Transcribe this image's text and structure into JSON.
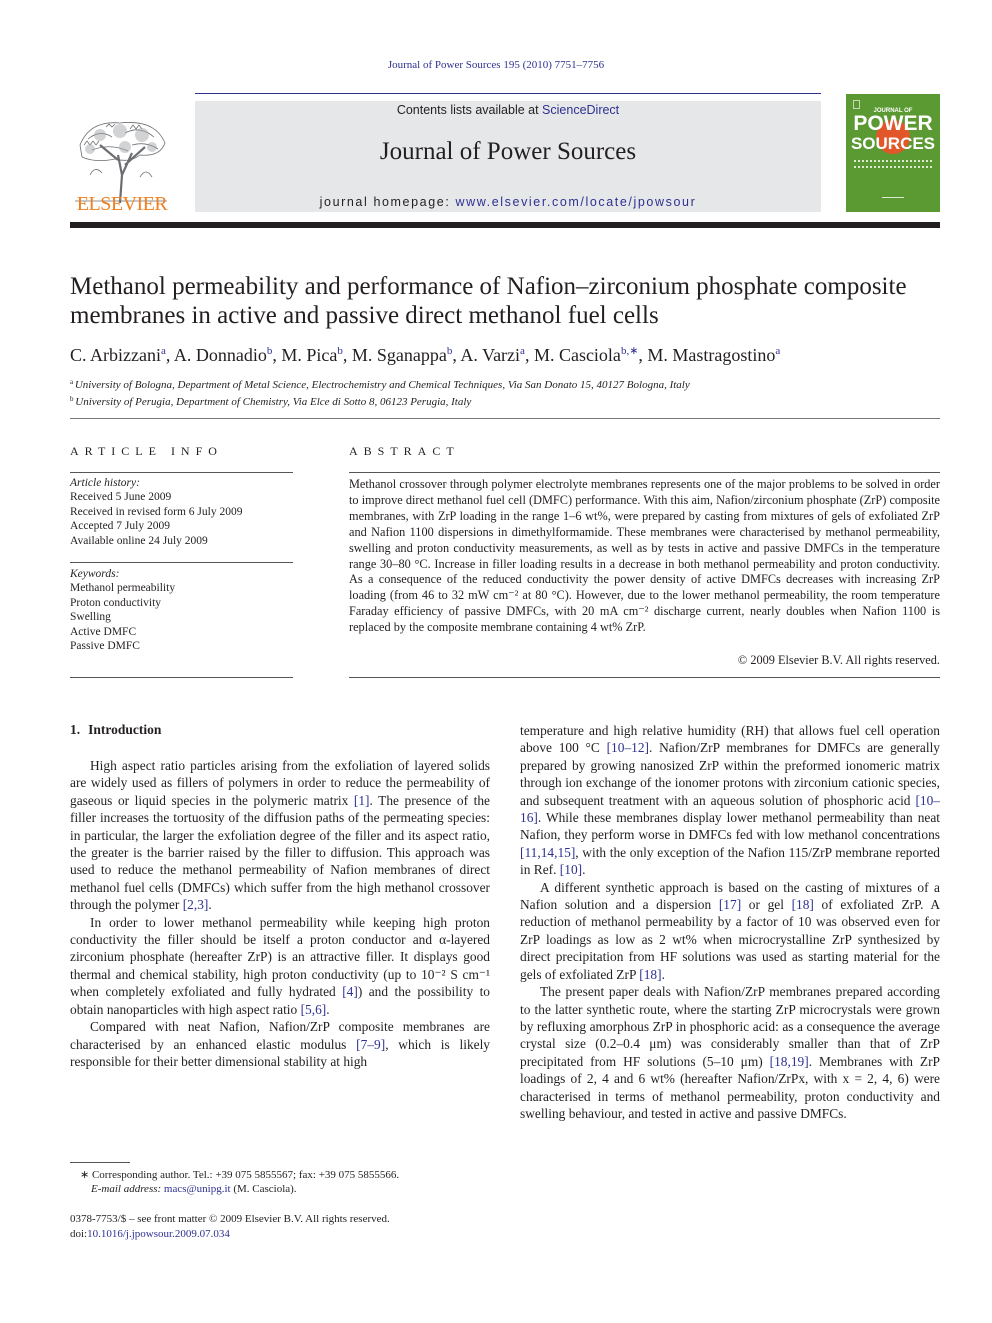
{
  "header": {
    "journal_ref": "Journal of Power Sources 195 (2010) 7751–7756",
    "contents_prefix": "Contents lists available at ",
    "contents_link": "ScienceDirect",
    "journal_title": "Journal of Power Sources",
    "homepage_prefix": "journal homepage: ",
    "homepage_link": "www.elsevier.com/locate/jpowsour",
    "publisher_logo_text": "ELSEVIER",
    "cover": {
      "line1": "JOURNAL OF",
      "line2": "POWER",
      "line3": "SOURCES"
    },
    "colors": {
      "link": "#2e3192",
      "elsevier_orange": "#f07f1d",
      "cover_green": "#5b9a32",
      "header_box": "#e6e7e8"
    }
  },
  "article": {
    "title": "Methanol permeability and performance of Nafion–zirconium phosphate composite membranes in active and passive direct methanol fuel cells",
    "authors": [
      {
        "name": "C. Arbizzani",
        "sup": "a"
      },
      {
        "name": "A. Donnadio",
        "sup": "b"
      },
      {
        "name": "M. Pica",
        "sup": "b"
      },
      {
        "name": "M. Sganappa",
        "sup": "b"
      },
      {
        "name": "A. Varzi",
        "sup": "a"
      },
      {
        "name": "M. Casciola",
        "sup": "b,∗"
      },
      {
        "name": "M. Mastragostino",
        "sup": "a"
      }
    ],
    "affiliations": [
      {
        "sup": "a",
        "text": "University of Bologna, Department of Metal Science, Electrochemistry and Chemical Techniques, Via San Donato 15, 40127 Bologna, Italy"
      },
      {
        "sup": "b",
        "text": "University of Perugia, Department of Chemistry, Via Elce di Sotto 8, 06123 Perugia, Italy"
      }
    ]
  },
  "article_info": {
    "heading": "ARTICLE INFO",
    "history_label": "Article history:",
    "history": [
      "Received 5 June 2009",
      "Received in revised form 6 July 2009",
      "Accepted 7 July 2009",
      "Available online 24 July 2009"
    ],
    "keywords_label": "Keywords:",
    "keywords": [
      "Methanol permeability",
      "Proton conductivity",
      "Swelling",
      "Active DMFC",
      "Passive DMFC"
    ]
  },
  "abstract": {
    "heading": "ABSTRACT",
    "body": "Methanol crossover through polymer electrolyte membranes represents one of the major problems to be solved in order to improve direct methanol fuel cell (DMFC) performance. With this aim, Nafion/zirconium phosphate (ZrP) composite membranes, with ZrP loading in the range 1–6 wt%, were prepared by casting from mixtures of gels of exfoliated ZrP and Nafion 1100 dispersions in dimethylformamide. These membranes were characterised by methanol permeability, swelling and proton conductivity measurements, as well as by tests in active and passive DMFCs in the temperature range 30–80 °C. Increase in filler loading results in a decrease in both methanol permeability and proton conductivity. As a consequence of the reduced conductivity the power density of active DMFCs decreases with increasing ZrP loading (from 46 to 32 mW cm⁻² at 80 °C). However, due to the lower methanol permeability, the room temperature Faraday efficiency of passive DMFCs, with 20 mA cm⁻² discharge current, nearly doubles when Nafion 1100 is replaced by the composite membrane containing 4 wt% ZrP.",
    "copyright": "© 2009 Elsevier B.V. All rights reserved."
  },
  "body": {
    "section_number": "1.",
    "section_title": "Introduction",
    "left_paragraphs": [
      [
        {
          "t": "High aspect ratio particles arising from the exfoliation of layered solids are widely used as fillers of polymers in order to reduce the permeability of gaseous or liquid species in the polymeric matrix "
        },
        {
          "ref": "[1]"
        },
        {
          "t": ". The presence of the filler increases the tortuosity of the diffusion paths of the permeating species: in particular, the larger the exfoliation degree of the filler and its aspect ratio, the greater is the barrier raised by the filler to diffusion. This approach was used to reduce the methanol permeability of Nafion membranes of direct methanol fuel cells (DMFCs) which suffer from the high methanol crossover through the polymer "
        },
        {
          "ref": "[2,3]"
        },
        {
          "t": "."
        }
      ],
      [
        {
          "t": "In order to lower methanol permeability while keeping high proton conductivity the filler should be itself a proton conductor and α-layered zirconium phosphate (hereafter ZrP) is an attractive filler. It displays good thermal and chemical stability, high proton conductivity (up to 10⁻² S cm⁻¹ when completely exfoliated and fully hydrated "
        },
        {
          "ref": "[4]"
        },
        {
          "t": ") and the possibility to obtain nanoparticles with high aspect ratio "
        },
        {
          "ref": "[5,6]"
        },
        {
          "t": "."
        }
      ],
      [
        {
          "t": "Compared with neat Nafion, Nafion/ZrP composite membranes are characterised by an enhanced elastic modulus "
        },
        {
          "ref": "[7–9]"
        },
        {
          "t": ", which is likely responsible for their better dimensional stability at high"
        }
      ]
    ],
    "right_paragraphs": [
      [
        {
          "t": "temperature and high relative humidity (RH) that allows fuel cell operation above 100 °C "
        },
        {
          "ref": "[10–12]"
        },
        {
          "t": ". Nafion/ZrP membranes for DMFCs are generally prepared by growing nanosized ZrP within the preformed ionomeric matrix through ion exchange of the ionomer protons with zirconium cationic species, and subsequent treatment with an aqueous solution of phosphoric acid "
        },
        {
          "ref": "[10–16]"
        },
        {
          "t": ". While these membranes display lower methanol permeability than neat Nafion, they perform worse in DMFCs fed with low methanol concentrations "
        },
        {
          "ref": "[11,14,15]"
        },
        {
          "t": ", with the only exception of the Nafion 115/ZrP membrane reported in Ref. "
        },
        {
          "ref": "[10]"
        },
        {
          "t": "."
        }
      ],
      [
        {
          "t": "A different synthetic approach is based on the casting of mixtures of a Nafion solution and a dispersion "
        },
        {
          "ref": "[17]"
        },
        {
          "t": " or gel "
        },
        {
          "ref": "[18]"
        },
        {
          "t": " of exfoliated ZrP. A reduction of methanol permeability by a factor of 10 was observed even for ZrP loadings as low as 2 wt% when microcrystalline ZrP synthesized by direct precipitation from HF solutions was used as starting material for the gels of exfoliated ZrP "
        },
        {
          "ref": "[18]"
        },
        {
          "t": "."
        }
      ],
      [
        {
          "t": "The present paper deals with Nafion/ZrP membranes prepared according to the latter synthetic route, where the starting ZrP microcrystals were grown by refluxing amorphous ZrP in phosphoric acid: as a consequence the average crystal size (0.2–0.4 μm) was considerably smaller than that of ZrP precipitated from HF solutions (5–10 μm) "
        },
        {
          "ref": "[18,19]"
        },
        {
          "t": ". Membranes with ZrP loadings of 2, 4 and 6 wt% (hereafter Nafion/ZrPx, with x = 2, 4, 6) were characterised in terms of methanol permeability, proton conductivity and swelling behaviour, and tested in active and passive DMFCs."
        }
      ]
    ]
  },
  "footnotes": {
    "corresponding": "∗ Corresponding author. Tel.: +39 075 5855567; fax: +39 075 5855566.",
    "email_label": "E-mail address: ",
    "email": "macs@unipg.it",
    "email_suffix": " (M. Casciola).",
    "front_matter": "0378-7753/$ – see front matter © 2009 Elsevier B.V. All rights reserved.",
    "doi_prefix": "doi:",
    "doi": "10.1016/j.jpowsour.2009.07.034"
  }
}
